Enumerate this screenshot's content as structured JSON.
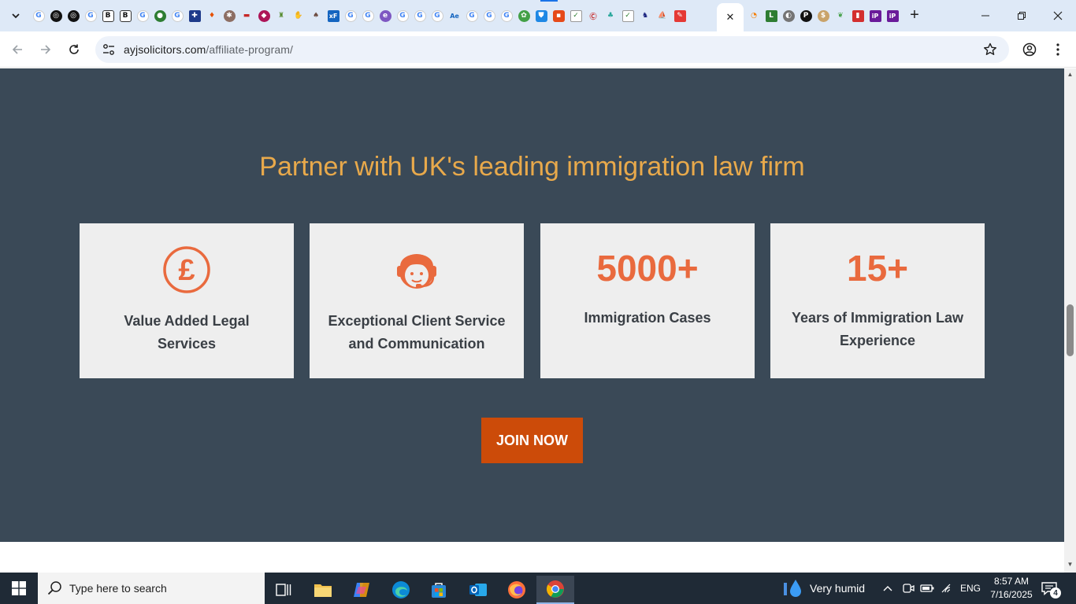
{
  "browser": {
    "url_host": "ayjsolicitors.com",
    "url_path": "/affiliate-program/",
    "active_tab_close": "✕",
    "new_tab": "+"
  },
  "page": {
    "headline": "Partner with UK's leading immigration law firm",
    "cards": [
      {
        "icon": "pound-icon",
        "label_line1": "Value Added Legal",
        "label_line2": "Services"
      },
      {
        "icon": "headset-agent-icon",
        "label_line1": "Exceptional Client Service",
        "label_line2": "and Communication"
      },
      {
        "stat": "5000+",
        "label_line1": "Immigration Cases"
      },
      {
        "stat": "15+",
        "label_line1": "Years of Immigration Law",
        "label_line2": "Experience"
      }
    ],
    "join_button": "JOIN NOW"
  },
  "taskbar": {
    "search_placeholder": "Type here to search",
    "weather": "Very humid",
    "language": "ENG",
    "time": "8:57 AM",
    "date": "7/16/2025",
    "notifications": "4"
  },
  "colors": {
    "section_bg": "#3a4957",
    "headline": "#e8a94b",
    "accent": "#e96a3e",
    "button": "#cc4b09",
    "card_bg": "#eeeeee"
  }
}
